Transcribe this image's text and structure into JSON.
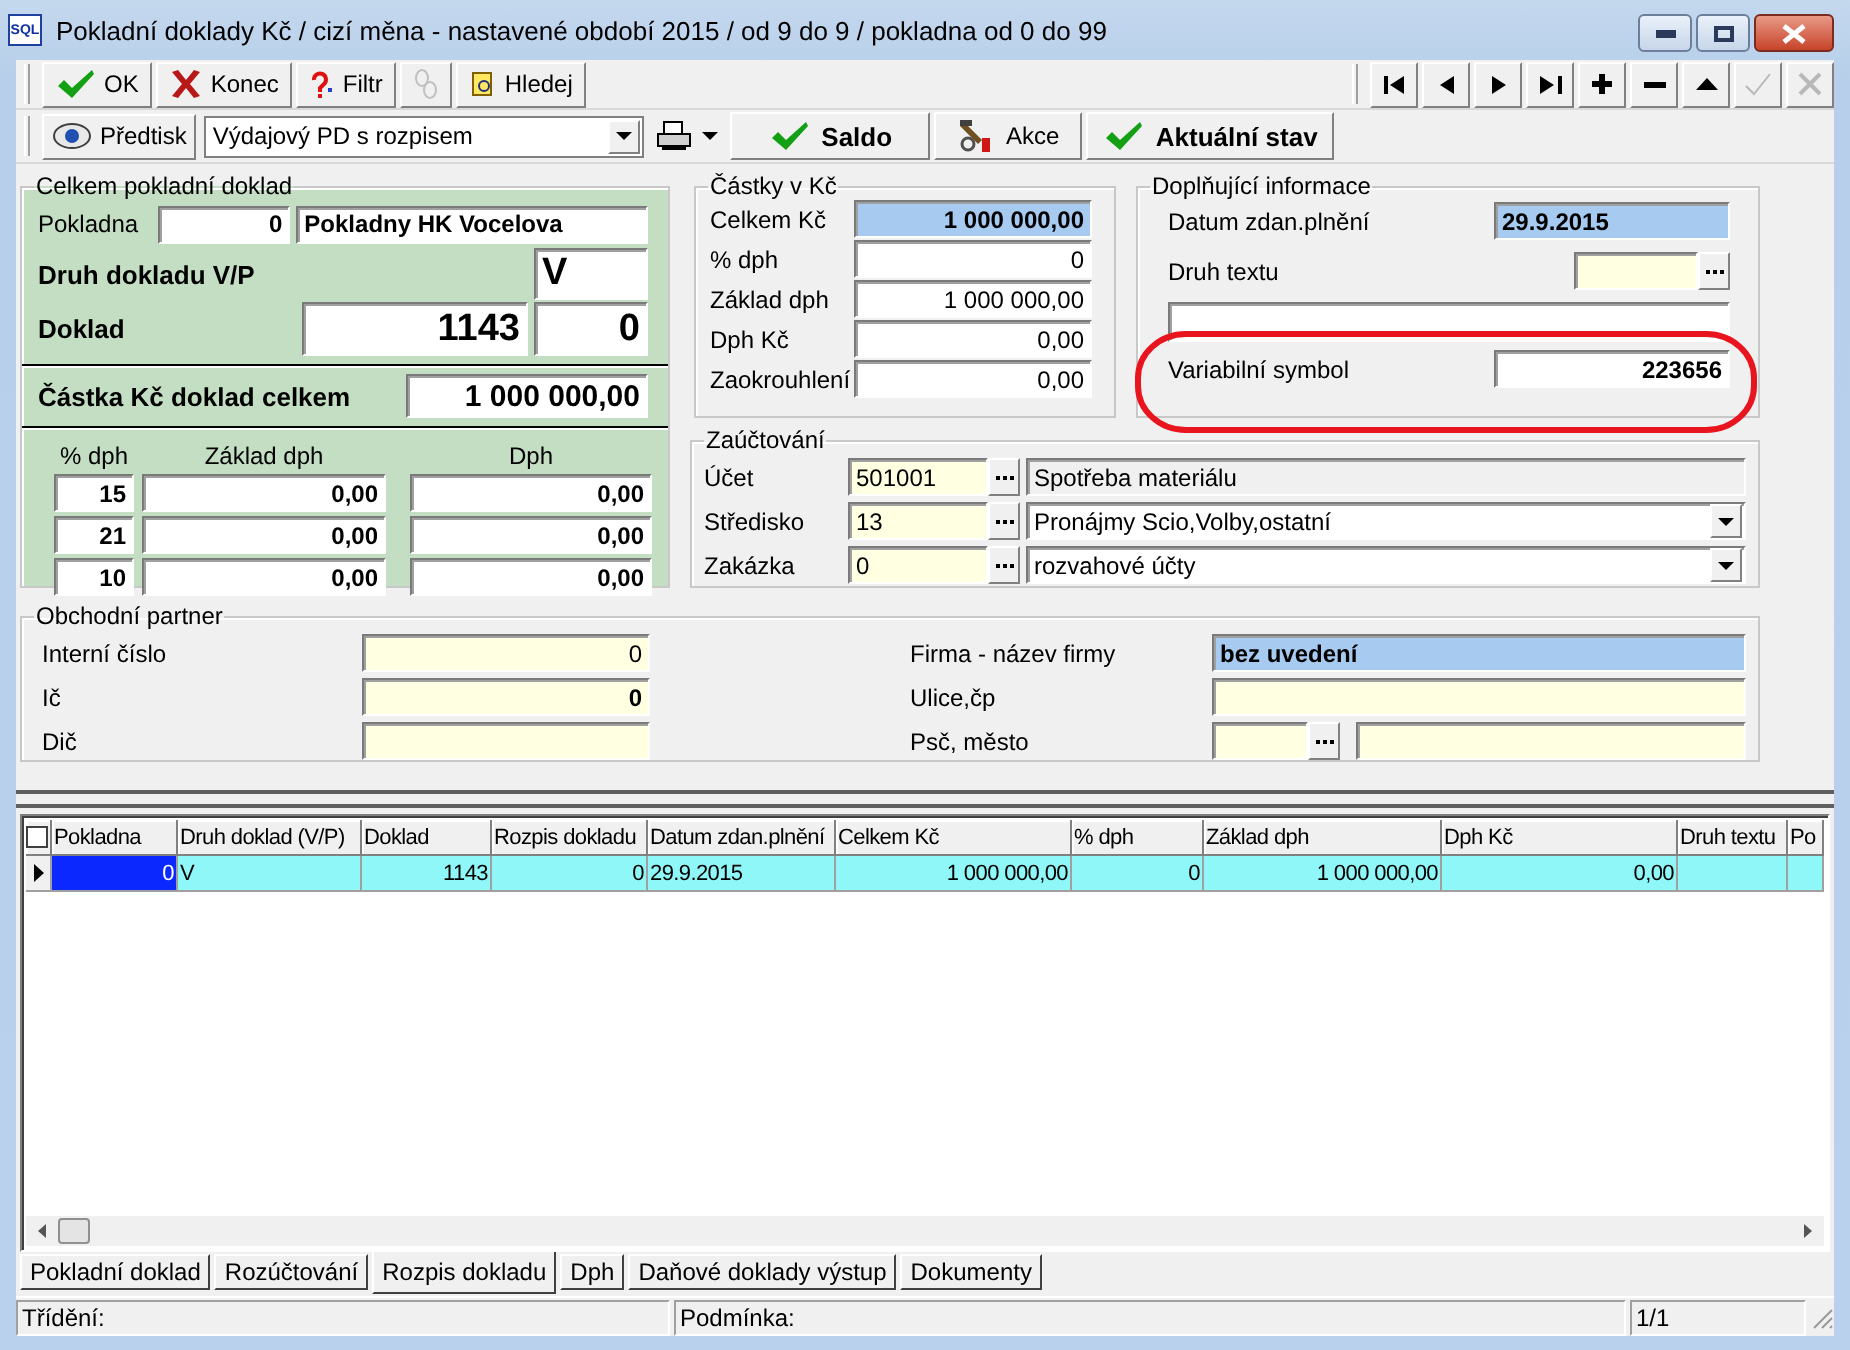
{
  "window": {
    "logo": "SQL",
    "title": "Pokladní doklady Kč / cizí měna - nastavené období 2015 / od 9 do 9 / pokladna od 0 do 99"
  },
  "toolbar": {
    "buttons": [
      {
        "kind": "ok",
        "label": "OK",
        "disabled": false
      },
      {
        "kind": "close",
        "label": "Konec",
        "disabled": false
      },
      {
        "kind": "filter",
        "label": "Filtr",
        "disabled": false
      },
      {
        "kind": "link",
        "disabled": true
      },
      {
        "kind": "search",
        "label": "Hledej",
        "disabled": false
      }
    ],
    "navigator": [
      {
        "kind": "first",
        "disabled": false
      },
      {
        "kind": "prev",
        "disabled": false
      },
      {
        "kind": "next",
        "disabled": false
      },
      {
        "kind": "last",
        "disabled": false
      },
      {
        "kind": "plus",
        "disabled": false
      },
      {
        "kind": "minus",
        "disabled": false
      },
      {
        "kind": "up",
        "disabled": false
      },
      {
        "kind": "post",
        "disabled": true
      },
      {
        "kind": "cancel",
        "disabled": true
      }
    ]
  },
  "actionbar": {
    "preprint": {
      "label": "Předtisk"
    },
    "template": {
      "value": "Výdajový PD s rozpisem"
    },
    "buttons": [
      {
        "kind": "check",
        "label": "Saldo",
        "bold": true
      },
      {
        "kind": "tools",
        "label": "Akce",
        "bold": false
      },
      {
        "kind": "check",
        "label": "Aktuální stav",
        "bold": true
      }
    ]
  },
  "summary_panel": {
    "title": "Celkem pokladní doklad",
    "cashbox": {
      "label": "Pokladna",
      "number": "0",
      "name": "Pokladny HK Vocelova"
    },
    "type": {
      "label": "Druh dokladu V/P",
      "value": "V"
    },
    "document": {
      "label": "Doklad",
      "number": "1143",
      "suffix": "0"
    },
    "total": {
      "label": "Částka Kč doklad celkem",
      "value": "1 000 000,00"
    },
    "vat_headers": [
      "% dph",
      "Základ dph",
      "Dph"
    ],
    "vat_rows": [
      {
        "rate": "15",
        "base": "0,00",
        "vat": "0,00"
      },
      {
        "rate": "21",
        "base": "0,00",
        "vat": "0,00"
      },
      {
        "rate": "10",
        "base": "0,00",
        "vat": "0,00"
      }
    ]
  },
  "amounts": {
    "title": "Částky v Kč",
    "rows": [
      {
        "label": "Celkem Kč",
        "value": "1 000 000,00",
        "highlighted": true
      },
      {
        "label": "% dph",
        "value": "0",
        "highlighted": false
      },
      {
        "label": "Základ dph",
        "value": "1 000 000,00",
        "highlighted": false
      },
      {
        "label": "Dph Kč",
        "value": "0,00",
        "highlighted": false
      },
      {
        "label": "Zaokrouhlení",
        "value": "0,00",
        "highlighted": false
      }
    ]
  },
  "extra": {
    "title": "Doplňující informace",
    "date": {
      "label": "Datum zdan.plnění",
      "value": "29.9.2015"
    },
    "text_type": {
      "label": "Druh textu"
    },
    "symbol": {
      "label": "Variabilní symbol",
      "value": "223656"
    }
  },
  "posting": {
    "title": "Zaúčtování",
    "rows": [
      {
        "kind": "lookup",
        "label": "Účet",
        "code": "501001",
        "name": "Spotřeba materiálu"
      },
      {
        "kind": "dropdown",
        "label": "Středisko",
        "code": "13",
        "name": "Pronájmy Scio,Volby,ostatní"
      },
      {
        "kind": "dropdown",
        "label": "Zakázka",
        "code": "0",
        "name": "rozvahové účty"
      }
    ]
  },
  "partner": {
    "title": "Obchodní partner",
    "left": [
      {
        "label": "Interní číslo",
        "value": "0",
        "bold": false
      },
      {
        "label": "Ič",
        "value": "0",
        "bold": true
      },
      {
        "label": "Dič"
      }
    ],
    "company": {
      "label": "Firma  - název firmy",
      "value": "bez uvedení"
    },
    "street": {
      "label": "Ulice,čp"
    },
    "city": {
      "label": "Psč, město"
    }
  },
  "grid": {
    "select_all": {
      "checked": false
    },
    "columns": [
      {
        "label": "Pokladna",
        "kind": "number"
      },
      {
        "label": "Druh doklad (V/P)",
        "kind": "text"
      },
      {
        "label": "Doklad",
        "kind": "number"
      },
      {
        "label": "Rozpis dokladu",
        "kind": "number"
      },
      {
        "label": "Datum zdan.plnění",
        "kind": "text"
      },
      {
        "label": "Celkem Kč",
        "kind": "number"
      },
      {
        "label": "% dph",
        "kind": "number"
      },
      {
        "label": "Základ dph",
        "kind": "number"
      },
      {
        "label": "Dph Kč",
        "kind": "number"
      },
      {
        "label": "Druh textu",
        "kind": "text"
      },
      {
        "label": "Po",
        "kind": "text"
      }
    ],
    "rows": [
      {
        "selected": true,
        "cells": [
          {
            "text": "0",
            "focused": true
          },
          {
            "text": "V",
            "focused": false
          },
          {
            "text": "1143",
            "focused": false
          },
          {
            "text": "0",
            "focused": false
          },
          {
            "text": "29.9.2015",
            "focused": false
          },
          {
            "text": "1 000 000,00",
            "focused": false
          },
          {
            "text": "0",
            "focused": false
          },
          {
            "text": "1 000 000,00",
            "focused": false
          },
          {
            "text": "0,00",
            "focused": false
          }
        ]
      }
    ]
  },
  "tabs": [
    {
      "label": "Pokladní doklad",
      "selected": false
    },
    {
      "label": "Rozúčtování",
      "selected": false
    },
    {
      "label": "Rozpis dokladu",
      "selected": true
    },
    {
      "label": "Dph",
      "selected": false
    },
    {
      "label": "Daňové doklady výstup",
      "selected": false
    },
    {
      "label": "Dokumenty",
      "selected": false
    }
  ],
  "status_bar": [
    "Třídění:",
    "Podmínka:",
    "1/1"
  ]
}
